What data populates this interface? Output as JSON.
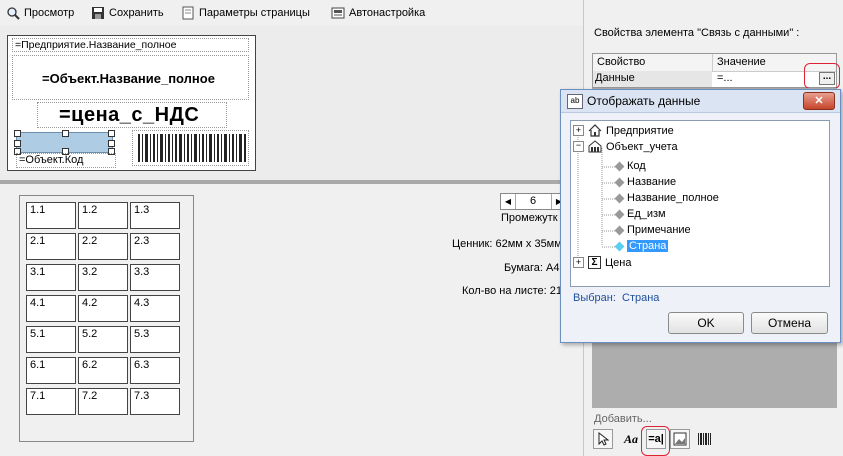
{
  "toolbar": {
    "preview": "Просмотр",
    "save": "Сохранить",
    "page_params": "Параметры страницы",
    "autosetup": "Автонастройка"
  },
  "label": {
    "enterprise": "=Предприятие.Название_полное",
    "object_name": "=Объект.Название_полное",
    "price": "=цена_с_НДС",
    "object_code": "=Объект.Код"
  },
  "grid": {
    "rows": [
      [
        "1.1",
        "1.2",
        "1.3"
      ],
      [
        "2.1",
        "2.2",
        "2.3"
      ],
      [
        "3.1",
        "3.2",
        "3.3"
      ],
      [
        "4.1",
        "4.2",
        "4.3"
      ],
      [
        "5.1",
        "5.2",
        "5.3"
      ],
      [
        "6.1",
        "6.2",
        "6.3"
      ],
      [
        "7.1",
        "7.2",
        "7.3"
      ]
    ]
  },
  "pager": {
    "value": "6"
  },
  "info": {
    "gap": "Промежутк",
    "tag": "Ценник: 62мм х 35мм",
    "paper": "Бумага: А4",
    "per_sheet": "Кол-во на листе: 21"
  },
  "props": {
    "title": "Свойства элемента \"Связь с данными\" :",
    "col_property": "Свойство",
    "col_value": "Значение",
    "row_name": "Данные",
    "row_value": "=...",
    "ellipsis": "..."
  },
  "dialog": {
    "title": "Отображать данные",
    "close": "✕",
    "tree": {
      "enterprise": "Предприятие",
      "object": "Объект_учета",
      "children": [
        "Код",
        "Название",
        "Название_полное",
        "Ед_изм",
        "Примечание",
        "Страна"
      ],
      "price": "Цена"
    },
    "selected_label": "Выбран:",
    "selected_value": "Страна",
    "ok": "OK",
    "cancel": "Отмена"
  },
  "add": {
    "label": "Добавить...",
    "text_tool": "=a|"
  },
  "colors": {
    "selection": "#3399ff",
    "accent_ring": "#dd2233",
    "dialog_title": "#dae4f2"
  }
}
